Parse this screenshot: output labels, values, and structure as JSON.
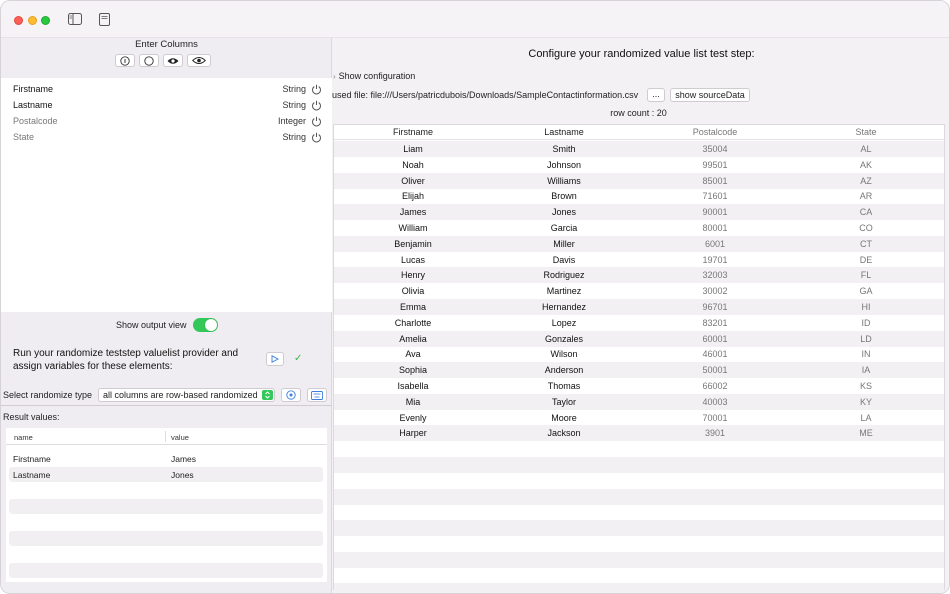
{
  "left": {
    "header": "Enter Columns",
    "columns": [
      {
        "name": "Firstname",
        "type": "String",
        "muted": false
      },
      {
        "name": "Lastname",
        "type": "String",
        "muted": false
      },
      {
        "name": "Postalcode",
        "type": "Integer",
        "muted": true
      },
      {
        "name": "State",
        "type": "String",
        "muted": true
      }
    ],
    "toggle_label": "Show output view",
    "toggle_on": true,
    "run_text": "Run your randomize teststep valuelist provider  and assign variables for these elements:",
    "randomize_label": "Select randomize type",
    "randomize_value": "all columns are row-based randomized",
    "result_label": "Result values:",
    "result_headers": {
      "name": "name",
      "value": "value"
    },
    "results": [
      {
        "name": "Firstname",
        "value": "James"
      },
      {
        "name": "Lastname",
        "value": "Jones"
      }
    ]
  },
  "right": {
    "title": "Configure your randomized value list test step:",
    "show_config": "Show configuration",
    "used_file": "used file: file:///Users/patricdubois/Downloads/SampleContactinformation.csv",
    "dots_label": "...",
    "source_button": "show sourceData",
    "row_count": "row count : 20",
    "table_headers": [
      "Firstname",
      "Lastname",
      "Postalcode",
      "State"
    ],
    "rows": [
      [
        "Liam",
        "Smith",
        "35004",
        "AL"
      ],
      [
        "Noah",
        "Johnson",
        "99501",
        "AK"
      ],
      [
        "Oliver",
        "Williams",
        "85001",
        "AZ"
      ],
      [
        "Elijah",
        "Brown",
        "71601",
        "AR"
      ],
      [
        "James",
        "Jones",
        "90001",
        "CA"
      ],
      [
        "William",
        "Garcia",
        "80001",
        "CO"
      ],
      [
        "Benjamin",
        "Miller",
        "6001",
        "CT"
      ],
      [
        "Lucas",
        "Davis",
        "19701",
        "DE"
      ],
      [
        "Henry",
        "Rodriguez",
        "32003",
        "FL"
      ],
      [
        "Olivia",
        "Martinez",
        "30002",
        "GA"
      ],
      [
        "Emma",
        "Hernandez",
        "96701",
        "HI"
      ],
      [
        "Charlotte",
        "Lopez",
        "83201",
        "ID"
      ],
      [
        "Amelia",
        "Gonzales",
        "60001",
        "LD"
      ],
      [
        "Ava",
        "Wilson",
        "46001",
        "IN"
      ],
      [
        "Sophia",
        "Anderson",
        "50001",
        "IA"
      ],
      [
        "Isabella",
        "Thomas",
        "66002",
        "KS"
      ],
      [
        "Mia",
        "Taylor",
        "40003",
        "KY"
      ],
      [
        "Evenly",
        "Moore",
        "70001",
        "LA"
      ],
      [
        "Harper",
        "Jackson",
        "3901",
        "ME"
      ]
    ]
  },
  "colors": {
    "accent_green": "#34c759",
    "alt_row": "#f2f0f3"
  }
}
